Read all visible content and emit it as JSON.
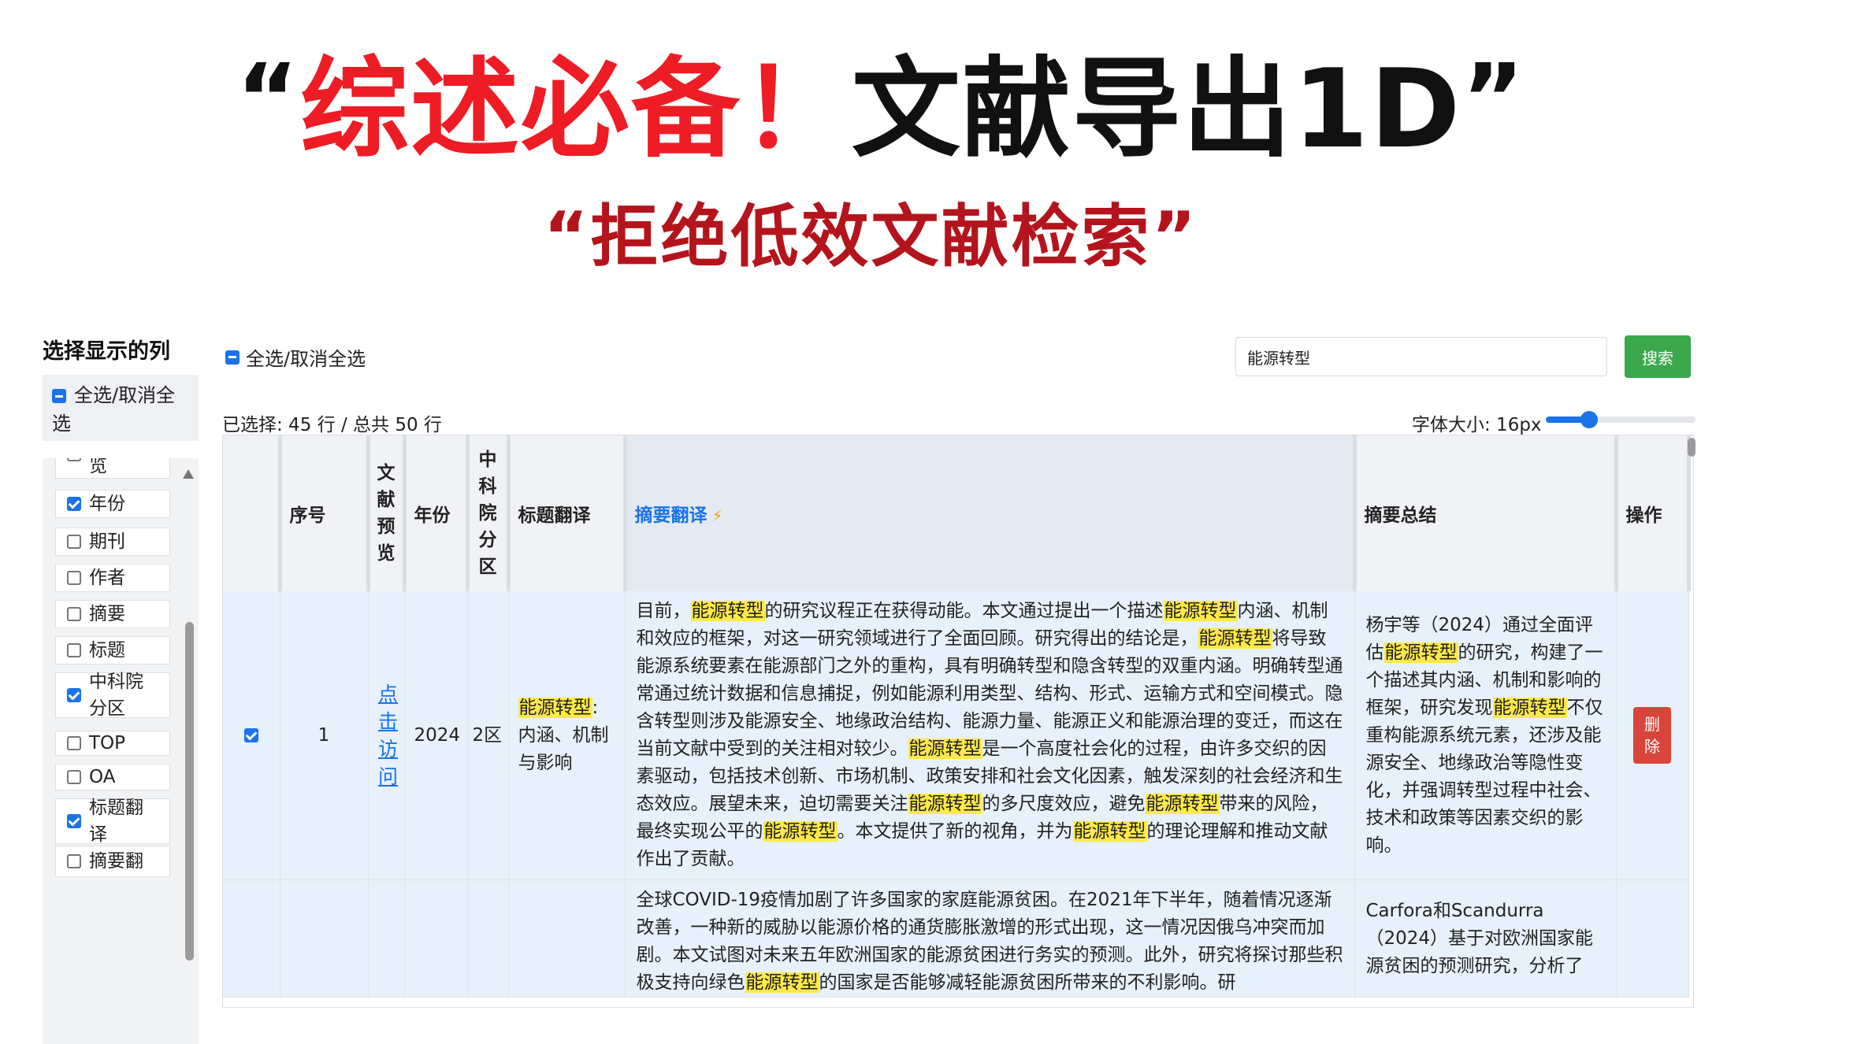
{
  "banner": {
    "open_quote": "“",
    "red_text": "综述必备！",
    "black_text": "文献导出1D",
    "close_quote": "”",
    "subtitle": "“拒绝低效文献检索”"
  },
  "sidebar": {
    "title": "选择显示的列",
    "select_all": {
      "label": "全选/取消全选",
      "state": "mixed"
    },
    "items": [
      {
        "label": "览",
        "checked": false,
        "partial": true
      },
      {
        "label": "年份",
        "checked": true
      },
      {
        "label": "期刊",
        "checked": false
      },
      {
        "label": "作者",
        "checked": false
      },
      {
        "label": "摘要",
        "checked": false
      },
      {
        "label": "标题",
        "checked": false
      },
      {
        "label": "中科院\n分区",
        "checked": true
      },
      {
        "label": "TOP",
        "checked": false
      },
      {
        "label": "OA",
        "checked": false
      },
      {
        "label": "标题翻\n译",
        "checked": true
      },
      {
        "label": "摘要翻",
        "checked": false,
        "partial": true
      }
    ]
  },
  "toolbar": {
    "select_all_label": "全选/取消全选",
    "search_value": "能源转型",
    "search_button": "搜索",
    "selected_info": "已选择: 45 行 / 总共 50 行",
    "font_size_label": "字体大小: 16px",
    "font_size_fraction": 0.29
  },
  "table": {
    "headers": {
      "index": "序号",
      "preview": "文献预览",
      "year": "年份",
      "cas": "中科院分区",
      "title_trans": "标题翻译",
      "abstract_trans": "摘要翻译",
      "summary": "摘要总结",
      "action": "操作"
    },
    "highlight": "能源转型",
    "rows": [
      {
        "checked": true,
        "index": "1",
        "preview_link": "点击访问",
        "year": "2024",
        "cas": "2区",
        "title_trans": "能源转型: 内涵、机制与影响",
        "abstract_trans": "目前，能源转型的研究议程正在获得动能。本文通过提出一个描述能源转型内涵、机制和效应的框架，对这一研究领域进行了全面回顾。研究得出的结论是，能源转型将导致能源系统要素在能源部门之外的重构，具有明确转型和隐含转型的双重内涵。明确转型通常通过统计数据和信息捕捉，例如能源利用类型、结构、形式、运输方式和空间模式。隐含转型则涉及能源安全、地缘政治结构、能源力量、能源正义和能源治理的变迁，而这在当前文献中受到的关注相对较少。能源转型是一个高度社会化的过程，由许多交织的因素驱动，包括技术创新、市场机制、政策安排和社会文化因素，触发深刻的社会经济和生态效应。展望未来，迫切需要关注能源转型的多尺度效应，避免能源转型带来的风险，最终实现公平的能源转型。本文提供了新的视角，并为能源转型的理论理解和推动文献作出了贡献。",
        "summary": "杨宇等（2024）通过全面评估能源转型的研究，构建了一个描述其内涵、机制和影响的框架，研究发现能源转型不仅重构能源系统元素，还涉及能源安全、地缘政治等隐性变化，并强调转型过程中社会、技术和政策等因素交织的影响。",
        "action": "删除"
      },
      {
        "checked": false,
        "index": "",
        "preview_link": "",
        "year": "",
        "cas": "",
        "title_trans": "",
        "abstract_trans": "全球COVID-19疫情加剧了许多国家的家庭能源贫困。在2021年下半年，随着情况逐渐改善，一种新的威胁以能源价格的通货膨胀激增的形式出现，这一情况因俄乌冲突而加剧。本文试图对未来五年欧洲国家的能源贫困进行务实的预测。此外，研究将探讨那些积极支持向绿色能源转型的国家是否能够减轻能源贫困所带来的不利影响。研",
        "summary": "Carfora和Scandurra（2024）基于对欧洲国家能源贫困的预测研究，分析了",
        "action": ""
      }
    ]
  },
  "colors": {
    "headline_red": "#ee1c25",
    "subtitle_red": "#b4141c",
    "accent_blue": "#1a73e8",
    "search_green": "#3aa84b",
    "delete_red": "#d9453b",
    "highlight_yellow": "#fde94a"
  }
}
